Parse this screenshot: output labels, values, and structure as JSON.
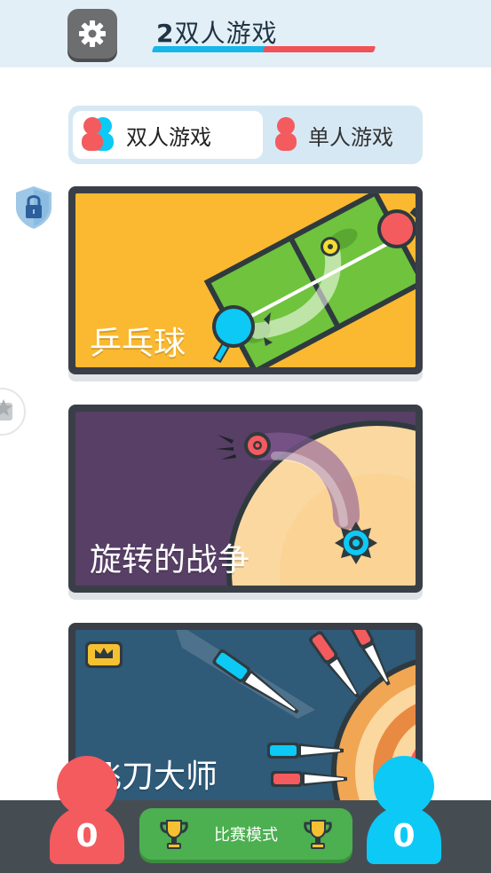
{
  "header": {
    "logo_number": "2",
    "logo_text": "双人游戏"
  },
  "mode_switch": {
    "two_player_label": "双人游戏",
    "single_player_label": "单人游戏",
    "selected": "双人游戏"
  },
  "games": [
    {
      "title": "乒乓球",
      "bg": "#fbb931"
    },
    {
      "title": "旋转的战争",
      "bg": "#573f66"
    },
    {
      "title": "飞刀大师",
      "bg": "#2f5a78"
    }
  ],
  "bottom": {
    "tournament_label": "比赛模式",
    "red_score": "0",
    "blue_score": "0"
  },
  "colors": {
    "red": "#f35b5e",
    "blue": "#0dc9f5",
    "green": "#4caf50",
    "dark": "#464d52"
  }
}
